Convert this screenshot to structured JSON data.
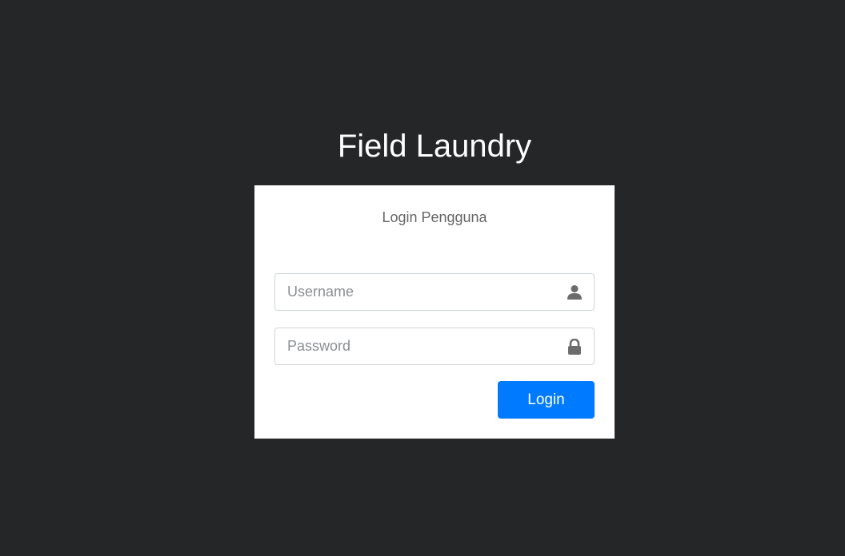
{
  "brand": {
    "title": "Field Laundry"
  },
  "login_card": {
    "title": "Login Pengguna",
    "username": {
      "placeholder": "Username",
      "value": "",
      "icon": "user-icon"
    },
    "password": {
      "placeholder": "Password",
      "value": "",
      "icon": "lock-icon"
    },
    "submit_label": "Login"
  },
  "colors": {
    "background": "#252628",
    "card": "#ffffff",
    "primary": "#007bff",
    "icon": "#6c6c6c"
  }
}
